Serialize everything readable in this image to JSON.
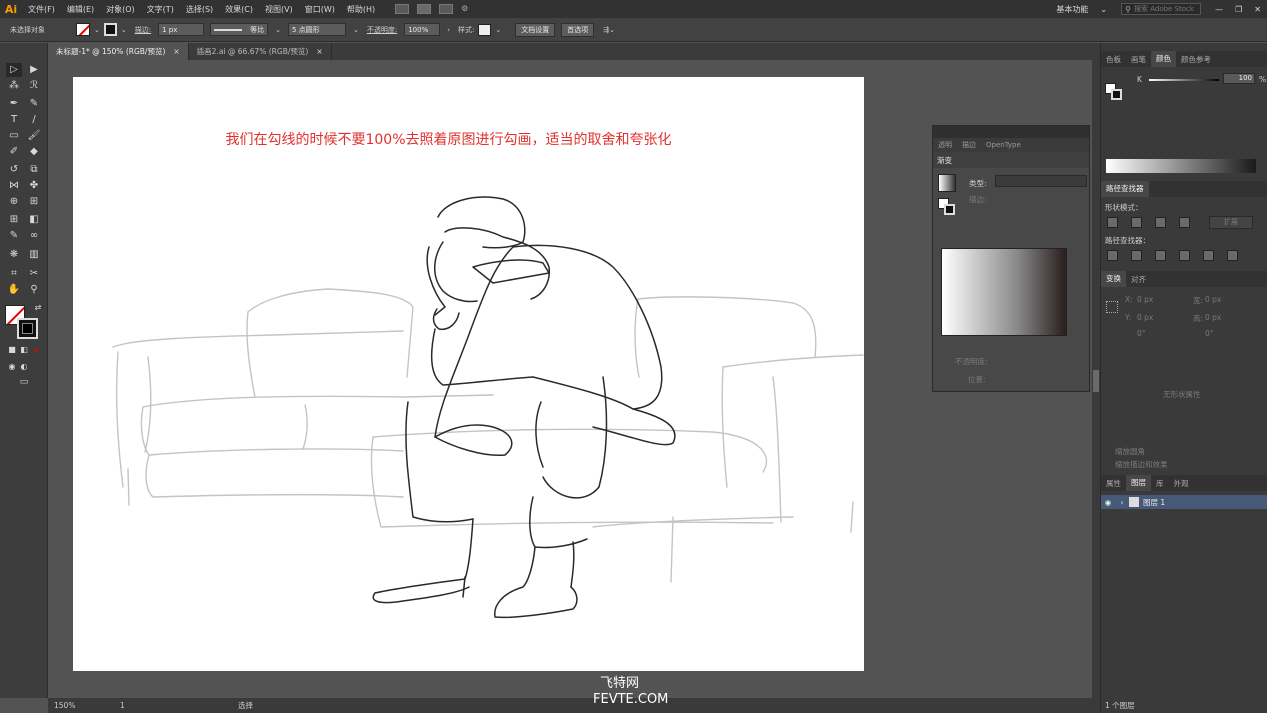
{
  "menubar": {
    "logo": "Ai",
    "items": [
      "文件(F)",
      "编辑(E)",
      "对象(O)",
      "文字(T)",
      "选择(S)",
      "效果(C)",
      "视图(V)",
      "窗口(W)",
      "帮助(H)"
    ],
    "workspace": "基本功能",
    "search_placeholder": "搜索 Adobe Stock"
  },
  "control": {
    "selection": "未选择对象",
    "stroke_label": "描边:",
    "stroke_value": "1 px",
    "profile": "等比",
    "brush": "5 点圆形",
    "opacity_label": "不透明度:",
    "opacity_value": "100%",
    "style_label": "样式:",
    "doc_setup": "文档设置",
    "prefs": "首选项"
  },
  "tabs": [
    {
      "label": "未标题-1* @ 150% (RGB/预览)",
      "close": "×"
    },
    {
      "label": "插画2.ai @ 66.67% (RGB/预览)",
      "close": "×"
    }
  ],
  "artboard": {
    "headline": "我们在勾线的时候不要100%去照着原图进行勾画，适当的取舍和夸张化"
  },
  "status": {
    "zoom": "150%",
    "page": "1",
    "tool": "选择"
  },
  "watermark": {
    "cn": "飞特网",
    "en": "FEVTE.COM"
  },
  "panels": {
    "top_tabs": [
      "色板",
      "画笔",
      "颜色",
      "颜色参考"
    ],
    "color_k_label": "K",
    "color_k_value": "100",
    "color_k_unit": "%",
    "pathfinder_title": "路径查找器",
    "shape_modes": "形状模式：",
    "expand_btn": "扩展",
    "pathfinders": "路径查找器：",
    "transform_tabs": [
      "变换",
      "对齐"
    ],
    "x_label": "X:",
    "x_val": "0 px",
    "y_label": "Y:",
    "y_val": "0 px",
    "w_label": "宽:",
    "w_val": "0 px",
    "h_label": "高:",
    "h_val": "0 px",
    "angle_val": "0°",
    "shear_val": "0°",
    "no_state": "无形状属性",
    "scale_corners": "缩放圆角",
    "scale_strokes": "缩放描边和效果",
    "layers_tabs": [
      "属性",
      "图层",
      "库",
      "外观"
    ],
    "layer_name": "图层 1",
    "layer_count": "1 个图层"
  },
  "gradient_panel": {
    "tabs": [
      "透明",
      "描边",
      "OpenType"
    ],
    "title": "渐变",
    "type_label": "类型:",
    "stroke_label": "描边:",
    "opacity_label": "不透明度:",
    "location_label": "位置:"
  }
}
